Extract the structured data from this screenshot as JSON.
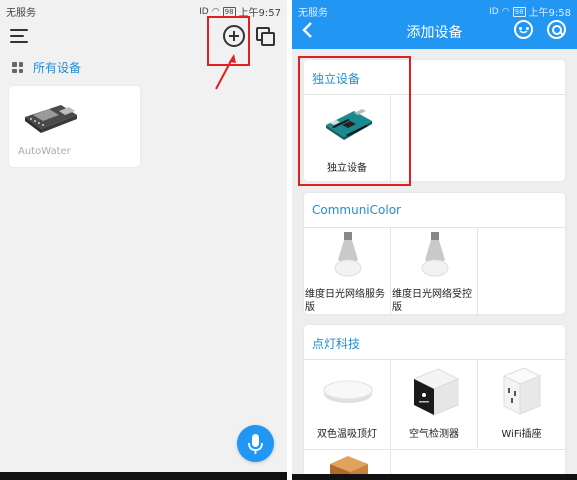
{
  "left": {
    "status": {
      "carrier": "无服务",
      "signal": "ID",
      "battery": "98",
      "time": "上午9:57"
    },
    "section_label": "所有设备",
    "devices": [
      {
        "name": "AutoWater"
      }
    ]
  },
  "right": {
    "status": {
      "carrier": "无服务",
      "signal": "ID",
      "battery": "98",
      "time": "上午9:58"
    },
    "title": "添加设备",
    "categories": [
      {
        "title": "独立设备",
        "items": [
          {
            "label": "独立设备",
            "icon": "arduino-board-icon"
          }
        ]
      },
      {
        "title": "CommuniColor",
        "items": [
          {
            "label": "维度日光网络服务",
            "label2": "版",
            "icon": "smart-bulb-icon"
          },
          {
            "label": "维度日光网络受控",
            "label2": "版",
            "icon": "smart-bulb-icon"
          }
        ]
      },
      {
        "title": "点灯科技",
        "items": [
          {
            "label": "双色温吸顶灯",
            "icon": "ceiling-light-icon"
          },
          {
            "label": "空气检测器",
            "icon": "air-monitor-icon"
          },
          {
            "label": "WiFi插座",
            "icon": "wifi-plug-icon"
          }
        ]
      }
    ]
  },
  "colors": {
    "accent": "#2196f3",
    "highlight": "#e02020",
    "section_text": "#1f8fd8"
  }
}
